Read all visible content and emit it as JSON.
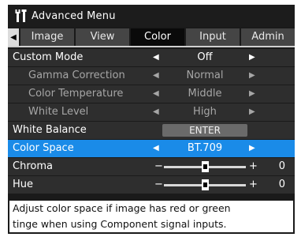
{
  "window": {
    "title": "Advanced Menu",
    "title_icon": "tools-icon"
  },
  "tabs": {
    "left_arrow_icon": "triangle-left-icon",
    "items": [
      {
        "label": "Image",
        "active": false
      },
      {
        "label": "View",
        "active": false
      },
      {
        "label": "Color",
        "active": true
      },
      {
        "label": "Input",
        "active": false
      },
      {
        "label": "Admin",
        "active": false
      }
    ]
  },
  "rows": {
    "custom_mode": {
      "label": "Custom Mode",
      "value": "Off"
    },
    "gamma": {
      "label": "Gamma Correction",
      "value": "Normal"
    },
    "color_temp": {
      "label": "Color Temperature",
      "value": "Middle"
    },
    "white_level": {
      "label": "White Level",
      "value": "High"
    },
    "white_balance": {
      "label": "White Balance",
      "button": "ENTER"
    },
    "color_space": {
      "label": "Color Space",
      "value": "BT.709",
      "selected": true
    },
    "chroma": {
      "label": "Chroma",
      "value": "0",
      "level": 0.5
    },
    "hue": {
      "label": "Hue",
      "value": "0",
      "level": 0.5
    }
  },
  "arrows": {
    "left": "◀",
    "right": "▶",
    "minus": "−",
    "plus": "+"
  },
  "help": {
    "line1": "Adjust color space if image has red or green",
    "line2": "tinge when using Component signal inputs."
  },
  "colors": {
    "highlight": "#1a8be8",
    "row_bg": "#2e2e2e",
    "disabled_text": "#a6a6a6"
  }
}
